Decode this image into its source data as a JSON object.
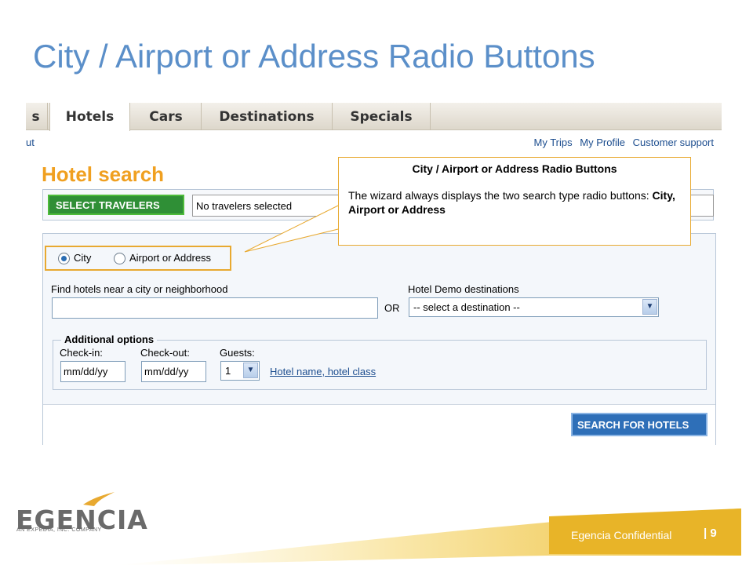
{
  "slide": {
    "title": "City / Airport or Address Radio Buttons"
  },
  "tabs": [
    {
      "label": "s"
    },
    {
      "label": "Hotels"
    },
    {
      "label": "Cars"
    },
    {
      "label": "Destinations"
    },
    {
      "label": "Specials"
    }
  ],
  "toplinks": {
    "left": "ut",
    "my_trips": "My Trips",
    "my_profile": "My Profile",
    "support": "Customer support"
  },
  "hotel_search": {
    "title": "Hotel search",
    "select_travelers_label": "SELECT TRAVELERS",
    "travelers_value": "No travelers selected",
    "radio_city_label": "City",
    "radio_airport_label": "Airport or Address",
    "radio_selected": "City",
    "find_label": "Find hotels near a city or neighborhood",
    "find_value": "",
    "or_label": "OR",
    "demo_label": "Hotel Demo destinations",
    "demo_value": "-- select a destination --",
    "additional_title": "Additional options",
    "checkin_label": "Check-in:",
    "checkin_value": "mm/dd/yy",
    "checkout_label": "Check-out:",
    "checkout_value": "mm/dd/yy",
    "guests_label": "Guests:",
    "guests_value": "1",
    "hotel_link": "Hotel name, hotel class",
    "search_button": "SEARCH FOR HOTELS"
  },
  "callout": {
    "title": "City / Airport or Address Radio Buttons",
    "body_prefix": "The wizard always displays the two search type radio buttons:  ",
    "body_bold": "City, Airport or Address"
  },
  "footer": {
    "logo": "EGENCIA",
    "logo_sub": "AN EXPEDIA, INC. COMPANY",
    "confidential": "Egencia Confidential",
    "page_number": "| 9"
  },
  "colors": {
    "title_blue": "#5b8fc9",
    "accent_orange": "#e8a930",
    "hotel_title_orange": "#f0a020",
    "link_blue": "#1d4e8f",
    "green_button": "#2f8f36",
    "search_button": "#2e6fb8"
  }
}
